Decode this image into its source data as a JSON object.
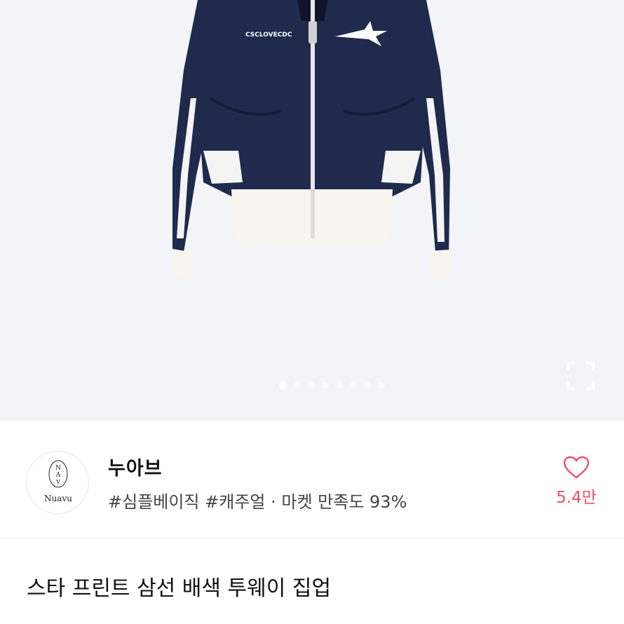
{
  "hero": {
    "jacket_print_text": "CSCLOVECDC",
    "image_index": 1,
    "expand_icon": "fullscreen-icon"
  },
  "store": {
    "logo_text": "Nuavu",
    "logo_monogram": "NAV",
    "name": "누아브",
    "tags": "#심플베이직 #캐주얼 · 마켓 만족도 93%"
  },
  "like": {
    "icon": "heart-icon",
    "count": "5.4만",
    "color": "#ef4f6b"
  },
  "product": {
    "title": "스타 프린트 삼선 배색 투웨이 집업"
  },
  "colors": {
    "jacket_navy": "#1f2a4d",
    "hero_bg": "#f3f4f8",
    "rib_white": "#f7f5f0"
  }
}
